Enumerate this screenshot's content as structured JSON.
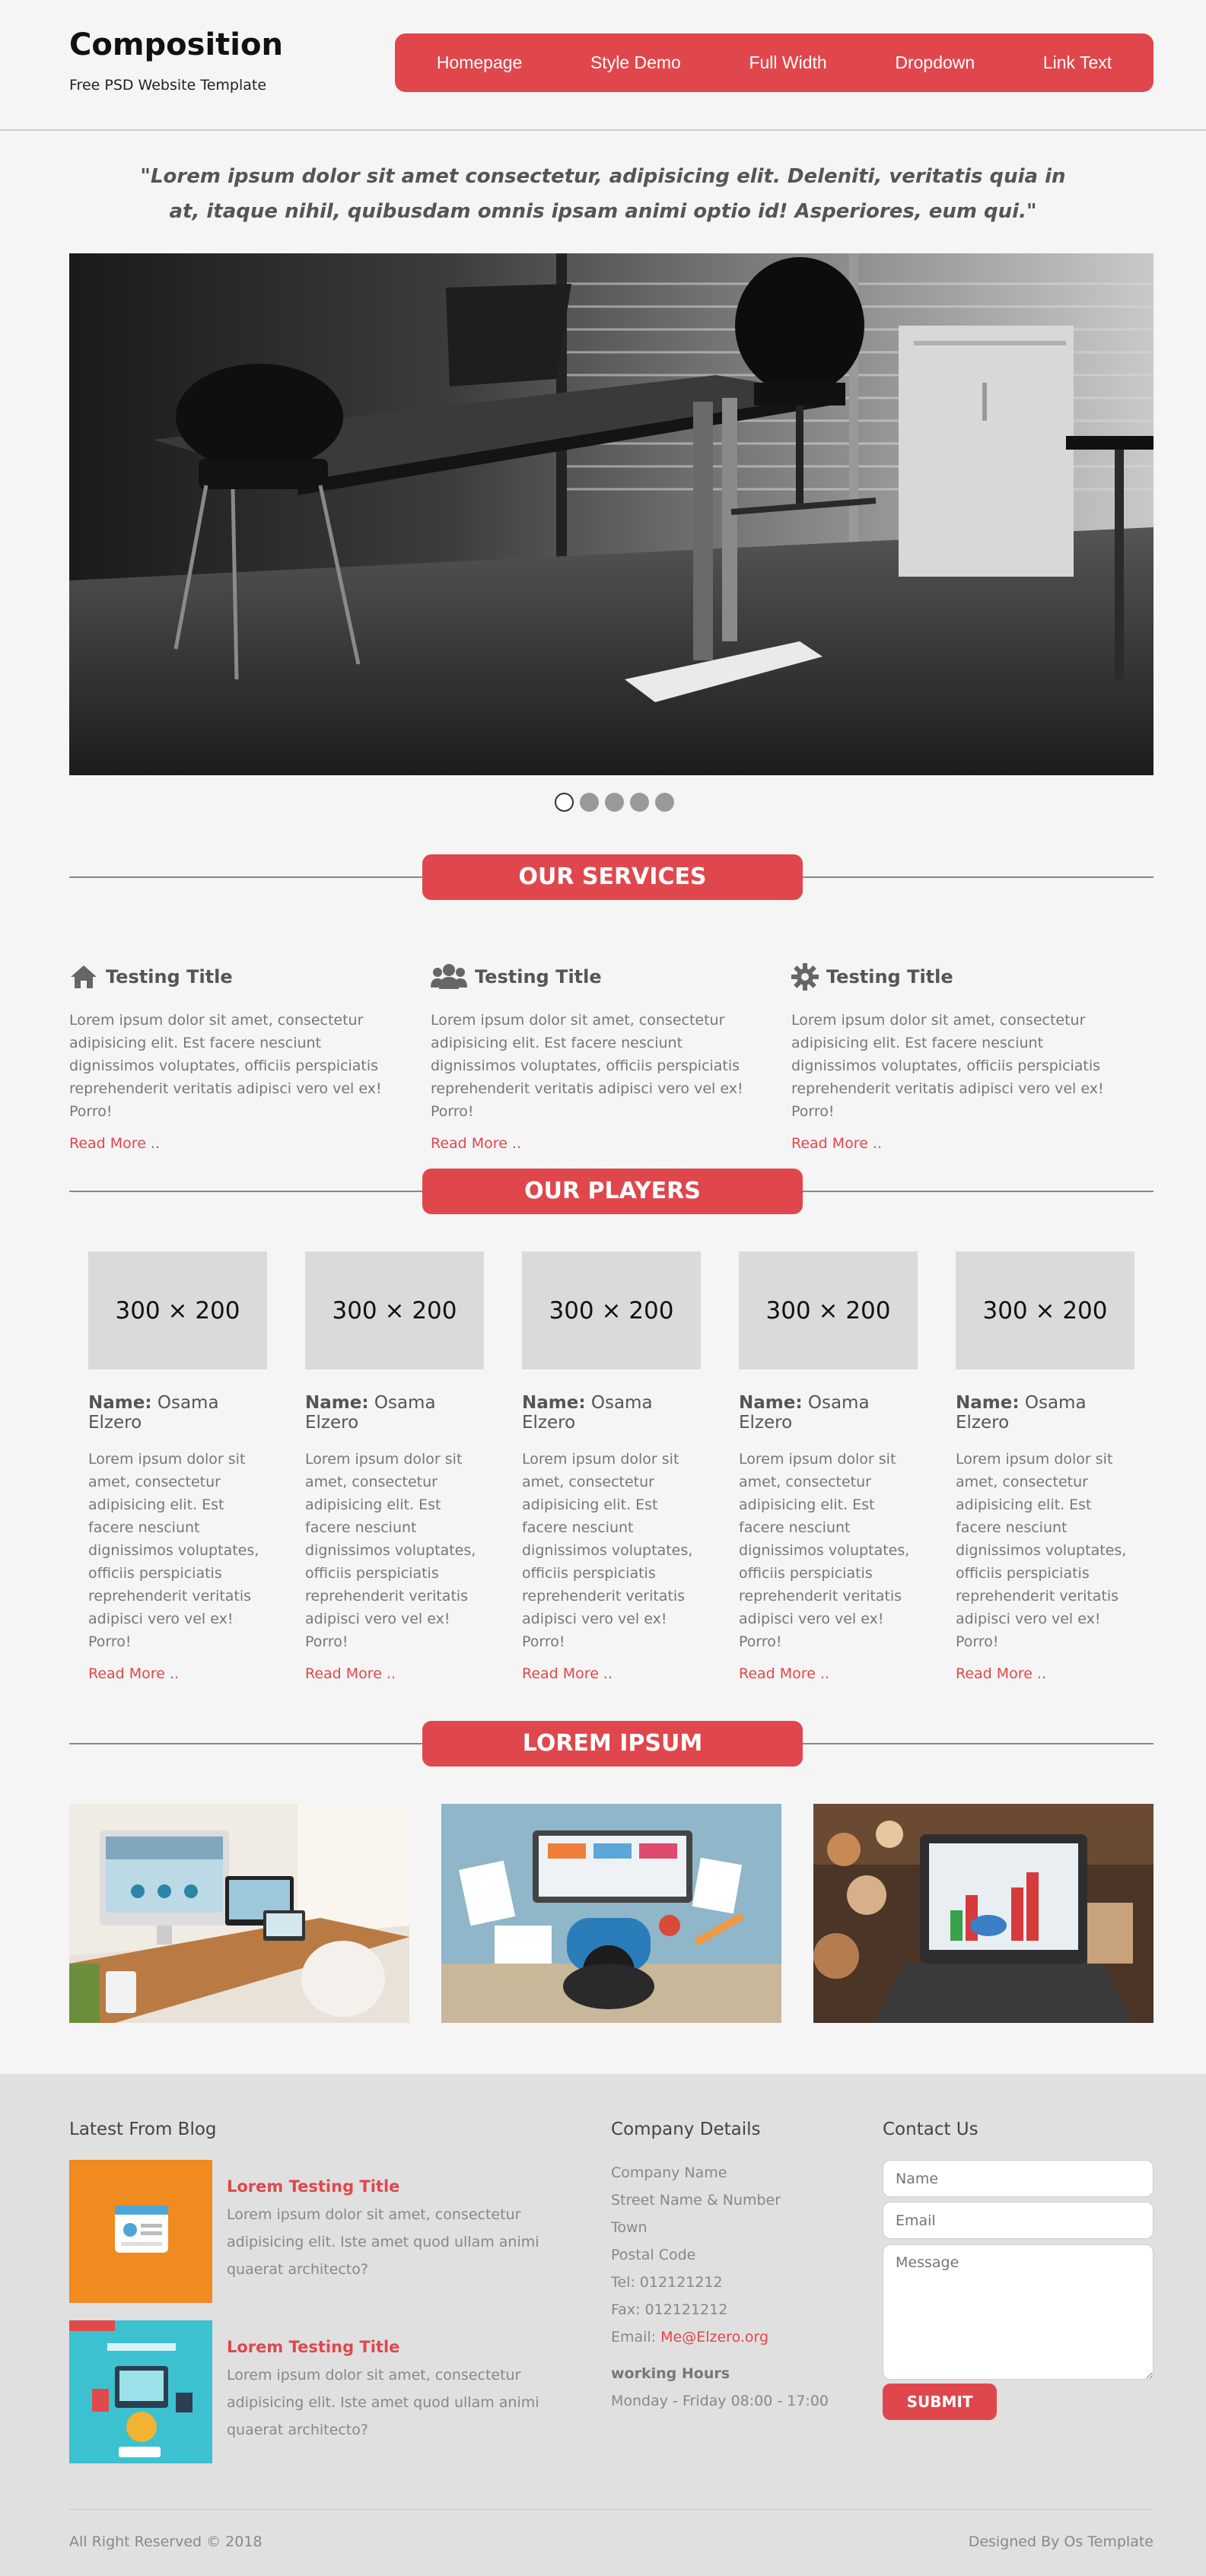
{
  "brand": {
    "title": "Composition",
    "subtitle": "Free PSD Website Template"
  },
  "nav": [
    "Homepage",
    "Style Demo",
    "Full Width",
    "Dropdown",
    "Link Text"
  ],
  "quote": "\"Lorem ipsum dolor sit amet consectetur, adipisicing elit. Deleniti, veritatis quia in at, itaque nihil, quibusdam omnis ipsam animi optio id! Asperiores, eum qui.\"",
  "slider": {
    "dots": 5,
    "active": 1
  },
  "services": {
    "heading": "OUR SERVICES",
    "items": [
      {
        "icon": "home-icon",
        "title": "Testing Title",
        "text": "Lorem ipsum dolor sit amet, consectetur adipisicing elit. Est facere nesciunt dignissimos voluptates, officiis perspiciatis reprehenderit veritatis adipisci vero vel ex! Porro!",
        "more": "Read More .."
      },
      {
        "icon": "users-icon",
        "title": "Testing Title",
        "text": "Lorem ipsum dolor sit amet, consectetur adipisicing elit. Est facere nesciunt dignissimos voluptates, officiis perspiciatis reprehenderit veritatis adipisci vero vel ex! Porro!",
        "more": "Read More .."
      },
      {
        "icon": "gear-icon",
        "title": "Testing Title",
        "text": "Lorem ipsum dolor sit amet, consectetur adipisicing elit. Est facere nesciunt dignissimos voluptates, officiis perspiciatis reprehenderit veritatis adipisci vero vel ex! Porro!",
        "more": "Read More .."
      }
    ]
  },
  "players": {
    "heading": "OUR PLAYERS",
    "name_label": "Name:",
    "items": [
      {
        "placeholder": "300 × 200",
        "name": "Osama Elzero",
        "text": "Lorem ipsum dolor sit amet, consectetur adipisicing elit. Est facere nesciunt dignissimos voluptates, officiis perspiciatis reprehenderit veritatis adipisci vero vel ex! Porro!",
        "more": "Read More .."
      },
      {
        "placeholder": "300 × 200",
        "name": "Osama Elzero",
        "text": "Lorem ipsum dolor sit amet, consectetur adipisicing elit. Est facere nesciunt dignissimos voluptates, officiis perspiciatis reprehenderit veritatis adipisci vero vel ex! Porro!",
        "more": "Read More .."
      },
      {
        "placeholder": "300 × 200",
        "name": "Osama Elzero",
        "text": "Lorem ipsum dolor sit amet, consectetur adipisicing elit. Est facere nesciunt dignissimos voluptates, officiis perspiciatis reprehenderit veritatis adipisci vero vel ex! Porro!",
        "more": "Read More .."
      },
      {
        "placeholder": "300 × 200",
        "name": "Osama Elzero",
        "text": "Lorem ipsum dolor sit amet, consectetur adipisicing elit. Est facere nesciunt dignissimos voluptates, officiis perspiciatis reprehenderit veritatis adipisci vero vel ex! Porro!",
        "more": "Read More .."
      },
      {
        "placeholder": "300 × 200",
        "name": "Osama Elzero",
        "text": "Lorem ipsum dolor sit amet, consectetur adipisicing elit. Est facere nesciunt dignissimos voluptates, officiis perspiciatis reprehenderit veritatis adipisci vero vel ex! Porro!",
        "more": "Read More .."
      }
    ]
  },
  "gallery": {
    "heading": "LOREM IPSUM"
  },
  "footer": {
    "blog": {
      "heading": "Latest From Blog",
      "posts": [
        {
          "title": "Lorem Testing Title",
          "text": "Lorem ipsum dolor sit amet, consectetur adipisicing elit. Iste amet quod ullam animi quaerat architecto?"
        },
        {
          "title": "Lorem Testing Title",
          "text": "Lorem ipsum dolor sit amet, consectetur adipisicing elit. Iste amet quod ullam animi quaerat architecto?"
        }
      ]
    },
    "company": {
      "heading": "Company Details",
      "name": "Company Name",
      "street": "Street Name & Number",
      "town": "Town",
      "postal": "Postal Code",
      "tel": "Tel: 012121212",
      "fax": "Fax: 012121212",
      "email_label": "Email: ",
      "email": "Me@Elzero.org",
      "hours_title": "working Hours",
      "hours": "Monday - Friday 08:00 - 17:00"
    },
    "contact": {
      "heading": "Contact Us",
      "name_placeholder": "Name",
      "email_placeholder": "Email",
      "message_placeholder": "Message",
      "submit": "SUBMIT"
    },
    "copyright": "All Right Reserved © 2018",
    "credit": "Designed By Os Template"
  },
  "colors": {
    "accent": "#e0474c",
    "footer_bg": "#e0e0e0",
    "page_bg": "#f5f5f5"
  }
}
